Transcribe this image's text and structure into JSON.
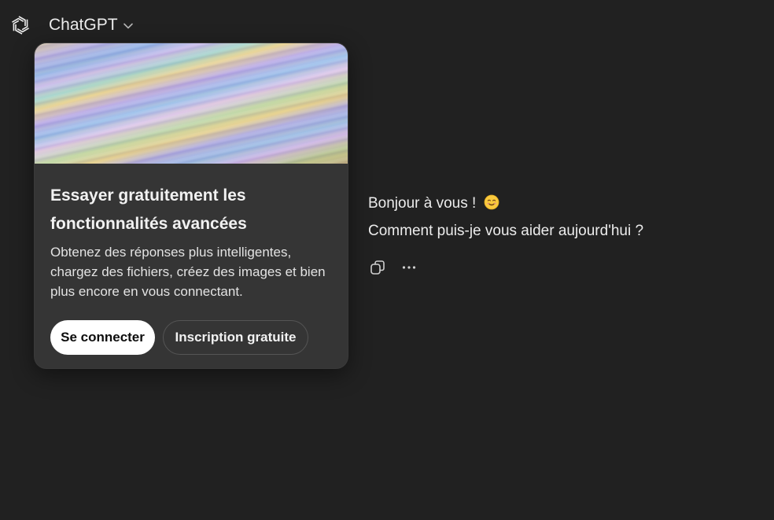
{
  "header": {
    "model_name": "ChatGPT",
    "logo_icon": "openai-logo-icon",
    "dropdown_icon": "chevron-down-icon"
  },
  "promo": {
    "title": "Essayer gratuitement les fonctionnalités avancées",
    "description": "Obtenez des réponses plus intelligentes, chargez des fichiers, créez des images et bien plus encore en vous connectant.",
    "login_label": "Se connecter",
    "signup_label": "Inscription gratuite"
  },
  "message": {
    "greeting": "Bonjour à vous !",
    "greeting_emoji": "😊",
    "question": "Comment puis-je vous aider aujourd'hui ?",
    "actions": [
      "copy-icon",
      "more-options-icon"
    ]
  },
  "colors": {
    "background": "#212121",
    "card": "#353535",
    "text": "#ececec",
    "button_primary": "#ffffff"
  }
}
